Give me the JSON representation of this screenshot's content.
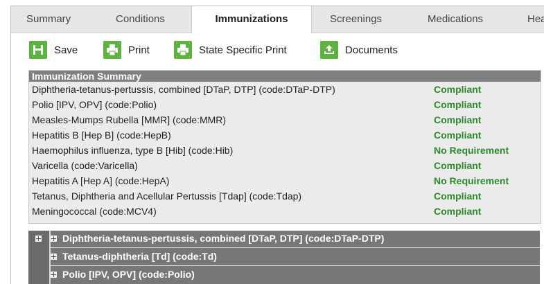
{
  "tabs": [
    {
      "label": "Summary"
    },
    {
      "label": "Conditions"
    },
    {
      "label": "Immunizations"
    },
    {
      "label": "Screenings"
    },
    {
      "label": "Medications"
    },
    {
      "label": "Hea"
    }
  ],
  "toolbar": {
    "save_label": "Save",
    "print_label": "Print",
    "state_print_label": "State Specific Print",
    "documents_label": "Documents"
  },
  "summary": {
    "title": "Immunization Summary",
    "rows": [
      {
        "name": "Diphtheria-tetanus-pertussis, combined [DTaP, DTP] (code:DTaP-DTP)",
        "status": "Compliant"
      },
      {
        "name": "Polio [IPV, OPV] (code:Polio)",
        "status": "Compliant"
      },
      {
        "name": "Measles-Mumps Rubella [MMR] (code:MMR)",
        "status": "Compliant"
      },
      {
        "name": "Hepatitis B [Hep B] (code:HepB)",
        "status": "Compliant"
      },
      {
        "name": "Haemophilus influenza, type B [Hib] (code:Hib)",
        "status": "No Requirement"
      },
      {
        "name": "Varicella (code:Varicella)",
        "status": "Compliant"
      },
      {
        "name": "Hepatitis A [Hep A] (code:HepA)",
        "status": "No Requirement"
      },
      {
        "name": "Tetanus, Diphtheria and Acellular Pertussis [Tdap] (code:Tdap)",
        "status": "Compliant"
      },
      {
        "name": "Meningococcal (code:MCV4)",
        "status": "Compliant"
      }
    ]
  },
  "tree": {
    "rows": [
      {
        "label": "Diphtheria-tetanus-pertussis, combined [DTaP, DTP] (code:DTaP-DTP)"
      },
      {
        "label": "Tetanus-diphtheria [Td] (code:Td)"
      },
      {
        "label": "Polio [IPV, OPV] (code:Polio)"
      }
    ]
  },
  "colors": {
    "accent_green": "#5db340",
    "status_green": "#2d8a2a",
    "header_gray": "#7f7f7f"
  }
}
